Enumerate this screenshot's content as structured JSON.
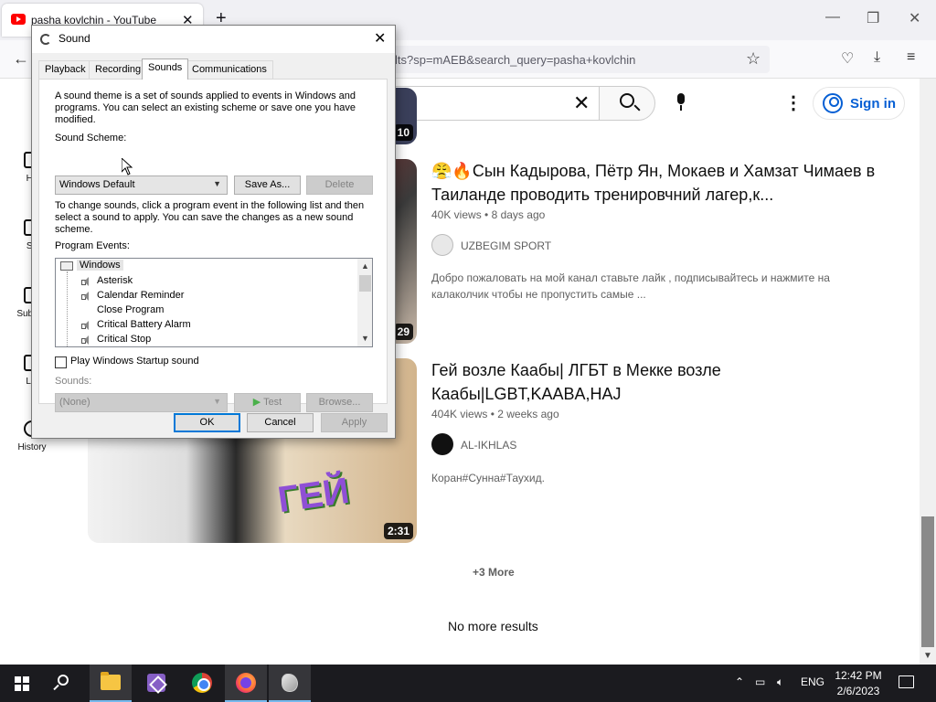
{
  "browser": {
    "tab_title": "pasha kovlchin - YouTube",
    "tab_close": "✕",
    "new_tab": "+",
    "url_text": "lts?sp=mAEB&search_query=pasha+kovlchin",
    "back": "←",
    "star": "☆",
    "window_controls": {
      "minimize": "—",
      "maximize": "❐",
      "close": "✕"
    }
  },
  "youtube": {
    "clear_search": "✕",
    "more": "⋮",
    "sign_in": "Sign in",
    "guide": [
      {
        "label": "Ho"
      },
      {
        "label": "Sh"
      },
      {
        "label": "Subscri"
      },
      {
        "label": "Lib"
      },
      {
        "label": "History"
      }
    ],
    "partial_duration": "10",
    "videos": [
      {
        "title": "😤🔥Сын Кадырова, Пётр Ян, Мокаев и Хамзат Чимаев в Таиланде проводить тренировчний лагер,к...",
        "views": "40K views",
        "age": "8 days ago",
        "channel": "UZBEGIM SPORT",
        "description": "Добро пожаловать на мой канал ставьте лайк , подписывайтесь и нажмите на калаколчик чтобы не пропустить самые ...",
        "duration": "29"
      },
      {
        "title": "Гей возле Каабы| ЛГБТ в Мекке возле Каабы|LGBT,KAABA,HAJ",
        "views": "404K views",
        "age": "2 weeks ago",
        "channel": "AL-IKHLAS",
        "description": "Коран#Сунна#Таухид.",
        "duration": "2:31",
        "thumb_text": "ГЕЙ"
      }
    ],
    "plus_more": "+3 More",
    "no_more": "No more results"
  },
  "dialog": {
    "title": "Sound",
    "close": "✕",
    "tabs": [
      "Playback",
      "Recording",
      "Sounds",
      "Communications"
    ],
    "active_tab": "Sounds",
    "intro": "A sound theme is a set of sounds applied to events in Windows and programs.  You can select an existing scheme or save one you have modified.",
    "scheme_label": "Sound Scheme:",
    "scheme_value": "Windows Default",
    "save_as": "Save As...",
    "delete": "Delete",
    "instructions": "To change sounds, click a program event in the following list and then select a sound to apply.  You can save the changes as a new sound scheme.",
    "events_label": "Program Events:",
    "events_root": "Windows",
    "events": [
      "Asterisk",
      "Calendar Reminder",
      "Close Program",
      "Critical Battery Alarm",
      "Critical Stop"
    ],
    "startup_label": "Play Windows Startup sound",
    "sounds_label": "Sounds:",
    "sounds_value": "(None)",
    "test": "Test",
    "browse": "Browse...",
    "ok": "OK",
    "cancel": "Cancel",
    "apply": "Apply"
  },
  "taskbar": {
    "language": "ENG",
    "time": "12:42 PM",
    "date": "2/6/2023"
  }
}
